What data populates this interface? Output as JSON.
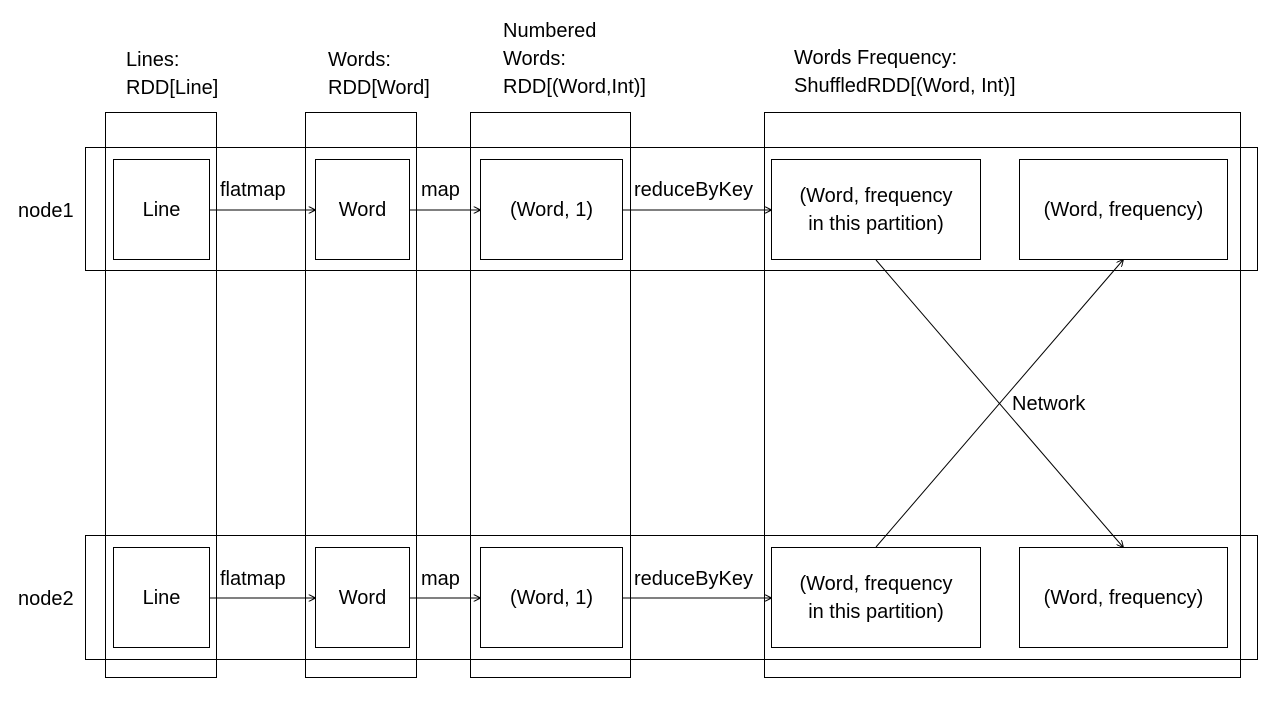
{
  "headers": {
    "lines": [
      "Lines:",
      "RDD[Line]"
    ],
    "words": [
      "Words:",
      "RDD[Word]"
    ],
    "numbered": [
      "Numbered",
      "Words:",
      "RDD[(Word,Int)]"
    ],
    "frequency": [
      "Words Frequency:",
      "ShuffledRDD[(Word, Int)]"
    ]
  },
  "nodes": [
    {
      "name": "node1",
      "line": "Line",
      "word": "Word",
      "pair": "(Word, 1)",
      "partial": [
        "(Word, frequency",
        "in this partition)"
      ],
      "final": "(Word, frequency)",
      "op_flatmap": "flatmap",
      "op_map": "map",
      "op_reduce": "reduceByKey"
    },
    {
      "name": "node2",
      "line": "Line",
      "word": "Word",
      "pair": "(Word, 1)",
      "partial": [
        "(Word, frequency",
        "in this partition)"
      ],
      "final": "(Word, frequency)",
      "op_flatmap": "flatmap",
      "op_map": "map",
      "op_reduce": "reduceByKey"
    }
  ],
  "network_label": "Network"
}
